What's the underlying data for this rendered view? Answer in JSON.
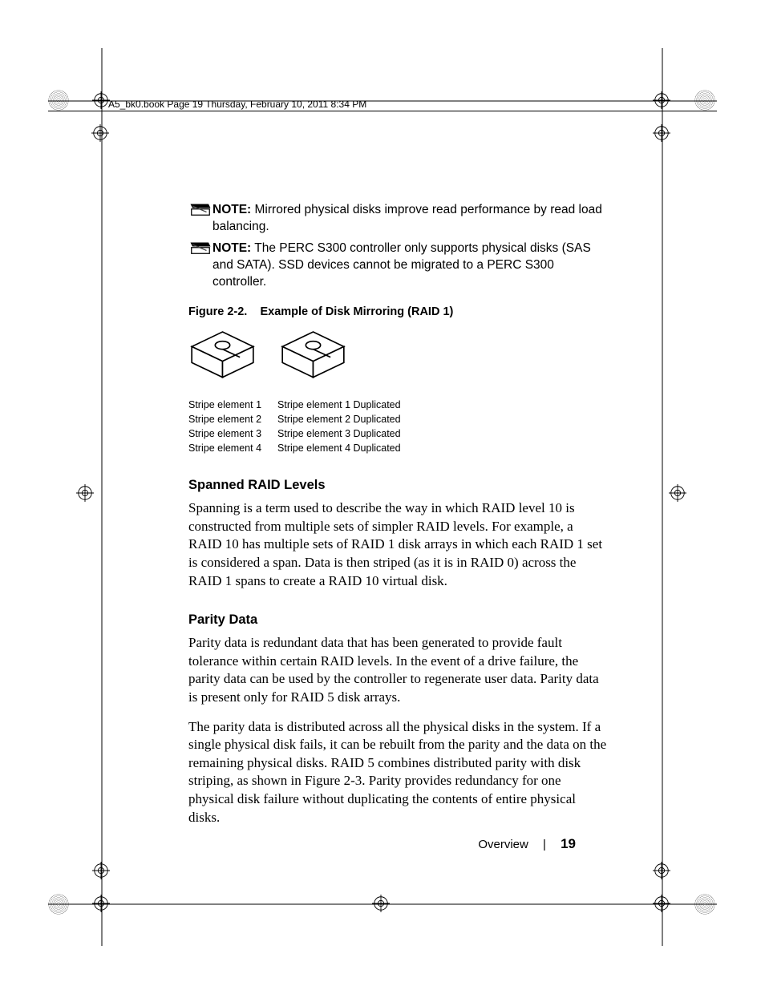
{
  "header": {
    "text": "A5_bk0.book  Page 19  Thursday, February 10, 2011  8:34 PM"
  },
  "notes": {
    "label": "NOTE:",
    "n1": " Mirrored physical disks improve read performance by read load balancing.",
    "n2": " The PERC S300 controller only supports physical disks (SAS and SATA). SSD devices cannot be migrated to a PERC S300 controller."
  },
  "figure": {
    "caption_label": "Figure 2-2.",
    "caption_title": "Example of Disk Mirroring (RAID 1)",
    "left": [
      "Stripe element 1",
      "Stripe element 2",
      "Stripe element 3",
      "Stripe element 4"
    ],
    "right": [
      "Stripe element 1 Duplicated",
      "Stripe element 2 Duplicated",
      "Stripe element 3 Duplicated",
      "Stripe element 4 Duplicated"
    ]
  },
  "sections": {
    "spanned": {
      "title": "Spanned RAID Levels",
      "body": "Spanning is a term used to describe the way in which RAID level 10 is constructed from multiple sets of simpler RAID levels. For example, a RAID 10 has multiple sets of RAID 1 disk arrays in which each RAID 1 set is considered a span. Data is then striped (as it is in RAID 0) across the RAID 1 spans to create a RAID 10 virtual disk."
    },
    "parity": {
      "title": "Parity Data",
      "p1": "Parity data is redundant data that has been generated to provide fault tolerance within certain RAID levels. In the event of a drive failure, the parity data can be used by the controller to regenerate user data. Parity data is present only for RAID 5 disk arrays.",
      "p2": "The parity data is distributed across all the physical disks in the system. If a single physical disk fails, it can be rebuilt from the parity and the data on the remaining physical disks. RAID 5 combines distributed parity with disk striping, as shown in Figure 2-3. Parity provides redundancy for one physical disk failure without duplicating the contents of entire physical disks."
    }
  },
  "footer": {
    "section": "Overview",
    "page": "19"
  }
}
